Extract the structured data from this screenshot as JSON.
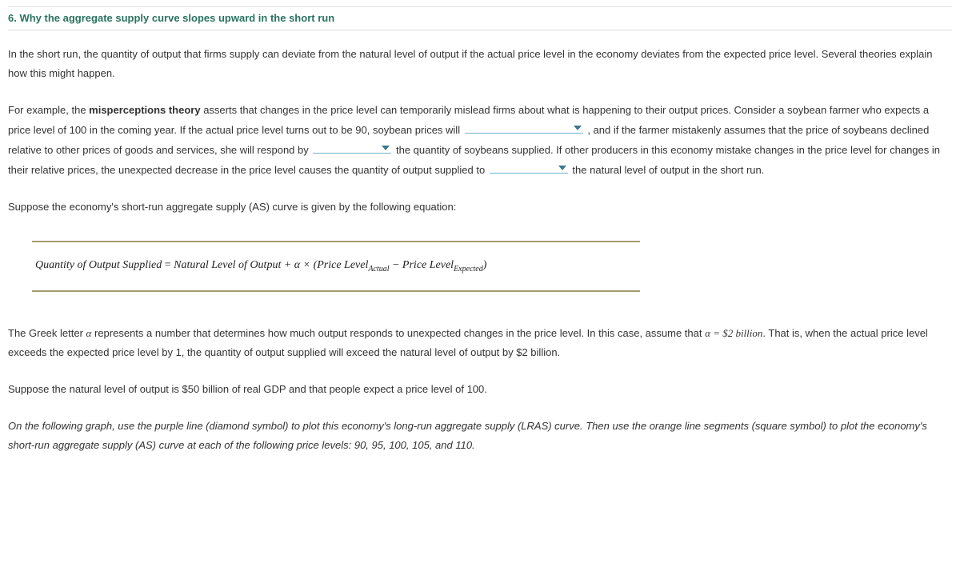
{
  "title": "6. Why the aggregate supply curve slopes upward in the short run",
  "para1": "In the short run, the quantity of output that firms supply can deviate from the natural level of output if the actual price level in the economy deviates from the expected price level. Several theories explain how this might happen.",
  "para2": {
    "t1": "For example, the ",
    "theory": "misperceptions theory",
    "t2": " asserts that changes in the price level can temporarily mislead firms about what is happening to their output prices. Consider a soybean farmer who expects a price level of 100 in the coming year. If the actual price level turns out to be 90, soybean prices will ",
    "t3": " , and if the farmer mistakenly assumes that the price of soybeans declined relative to other prices of goods and services, she will respond by ",
    "t4": " the quantity of soybeans supplied. If other producers in this economy mistake changes in the price level for changes in their relative prices, the unexpected decrease in the price level causes the quantity of output supplied to ",
    "t5": " the natural level of output in the short run."
  },
  "para3": "Suppose the economy's short-run aggregate supply (AS) curve is given by the following equation:",
  "equation": {
    "lhs": "Quantity of Output Supplied",
    "eq": " = ",
    "rhs1": "Natural Level of Output + α × (Price Level",
    "sub1": "Actual",
    "mid": " − Price Level",
    "sub2": "Expected",
    "end": ")"
  },
  "para4": {
    "t1": "The Greek letter ",
    "alpha1": "α",
    "t2": " represents a number that determines how much output responds to unexpected changes in the price level. In this case, assume that ",
    "alpha2": "α = $2 billion",
    "t3": ". That is, when the actual price level exceeds the expected price level by 1, the quantity of output supplied will exceed the natural level of output by $2 billion."
  },
  "para5": "Suppose the natural level of output is $50 billion of real GDP and that people expect a price level of 100.",
  "para6": "On the following graph, use the purple line (diamond symbol) to plot this economy's long-run aggregate supply (LRAS) curve. Then use the orange line segments (square symbol) to plot the economy's short-run aggregate supply (AS) curve at each of the following price levels: 90, 95, 100, 105, and 110."
}
